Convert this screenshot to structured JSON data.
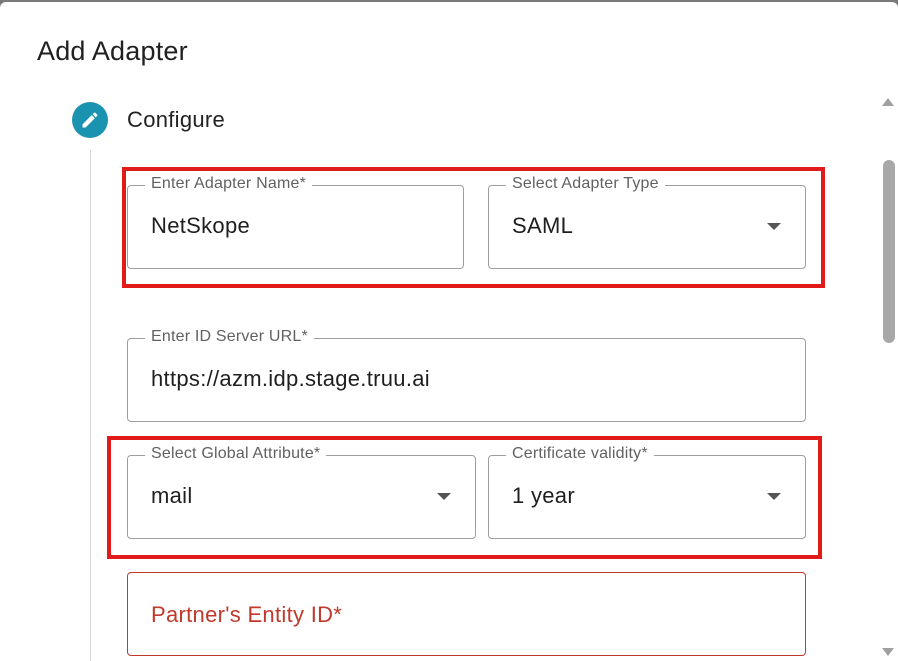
{
  "dialog": {
    "title": "Add Adapter"
  },
  "step": {
    "label": "Configure",
    "icon": "pencil-icon",
    "color": "#1a93b0"
  },
  "fields": {
    "adapter_name": {
      "label": "Enter Adapter Name*",
      "value": "NetSkope"
    },
    "adapter_type": {
      "label": "Select Adapter Type",
      "value": "SAML"
    },
    "id_server_url": {
      "label": "Enter ID Server URL*",
      "value": "https://azm.idp.stage.truu.ai"
    },
    "global_attribute": {
      "label": "Select Global Attribute*",
      "value": "mail"
    },
    "certificate_validity": {
      "label": "Certificate validity*",
      "value": "1 year"
    },
    "partner_entity_id": {
      "placeholder": "Partner's Entity ID*"
    }
  },
  "colors": {
    "highlight": "#e11a1a",
    "error": "#c0392b",
    "step_accent": "#1a93b0"
  }
}
